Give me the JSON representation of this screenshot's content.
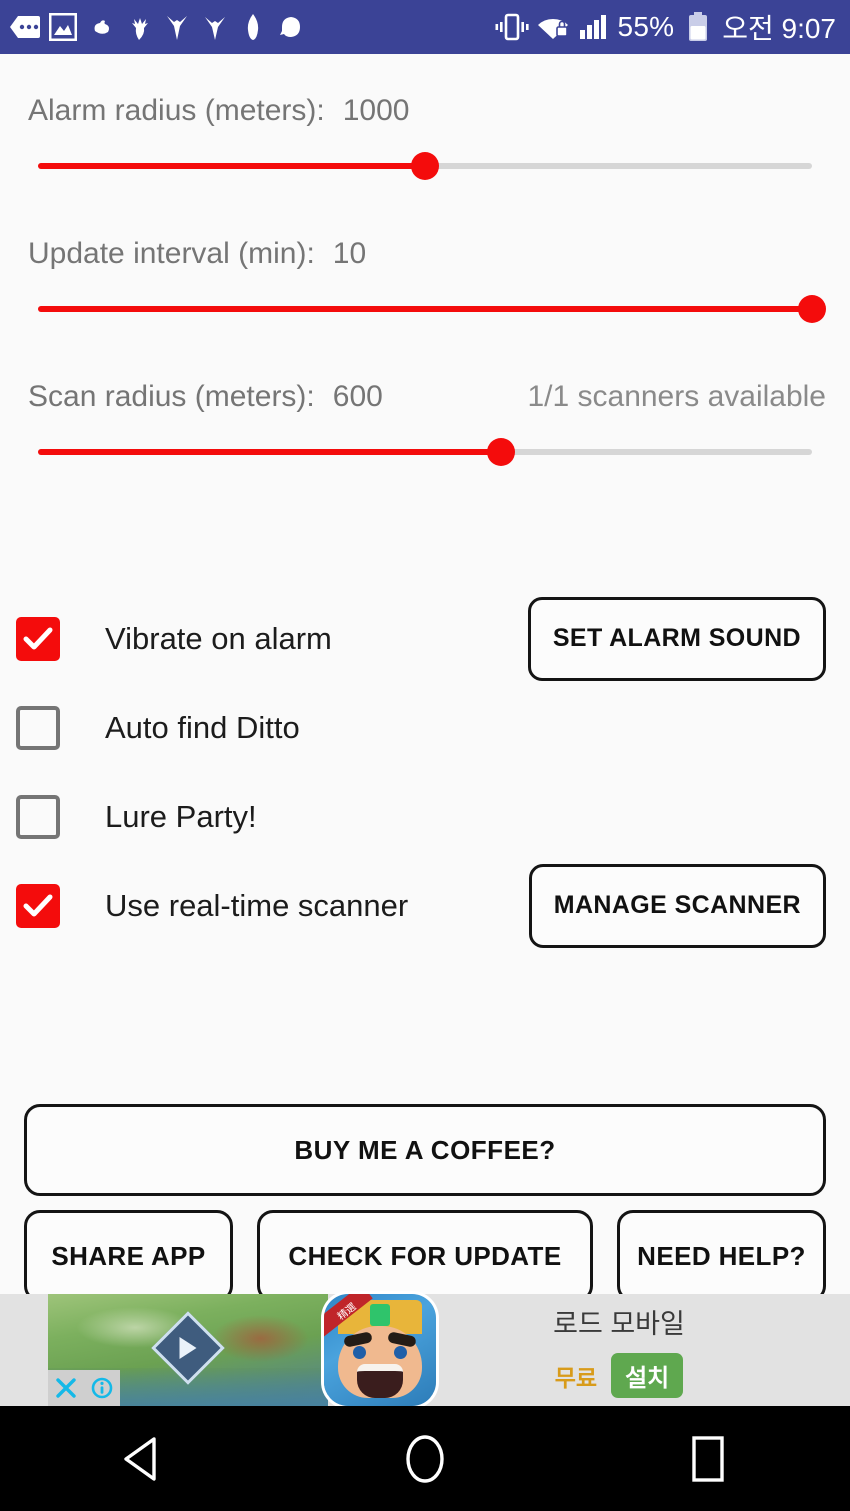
{
  "status_bar": {
    "background": "#3b4396",
    "notification_icons": [
      "message-dots-icon",
      "image-icon",
      "pokemon-shape-1-icon",
      "pokemon-shape-2-icon",
      "pokemon-shape-3-icon",
      "pokemon-shape-4-icon",
      "pokemon-shape-5-icon",
      "pokemon-shape-6-icon"
    ],
    "vibrate_icon": "vibrate-icon",
    "wifi_icon": "wifi-lock-icon",
    "signal_icon": "cellular-signal-icon",
    "battery_percent": "55%",
    "battery_icon": "battery-icon",
    "time": "오전 9:07"
  },
  "settings": {
    "accent_color": "#f40c0c",
    "track_color": "#d6d6d6",
    "label_color": "#757575",
    "sliders": [
      {
        "label": "Alarm radius (meters):",
        "value": "1000",
        "aux": "",
        "fill_percent": 50
      },
      {
        "label": "Update interval (min):",
        "value": "10",
        "aux": "",
        "fill_percent": 100
      },
      {
        "label": "Scan radius (meters):",
        "value": "600",
        "aux": "1/1 scanners available",
        "fill_percent": 59.8
      }
    ],
    "checkboxes": [
      {
        "label": "Vibrate on alarm",
        "checked": true,
        "button": "SET ALARM SOUND"
      },
      {
        "label": "Auto find Ditto",
        "checked": false,
        "button": ""
      },
      {
        "label": "Lure Party!",
        "checked": false,
        "button": ""
      },
      {
        "label": "Use real-time scanner",
        "checked": true,
        "button": "MANAGE SCANNER"
      }
    ]
  },
  "bottom_buttons": {
    "wide": "BUY ME A COFFEE?",
    "row": [
      "SHARE APP",
      "CHECK FOR UPDATE",
      "NEED HELP?"
    ]
  },
  "ad": {
    "title": "로드 모바일",
    "free_label": "무료",
    "install_label": "설치",
    "ribbon_text": "精選",
    "close_icon": "close-x-icon",
    "info_icon": "info-icon",
    "play_icon": "play-icon",
    "install_color": "#5fa84f",
    "free_color": "#d89b1a"
  },
  "nav_bar": {
    "back": "back-triangle-icon",
    "home": "home-circle-icon",
    "recents": "recents-square-icon"
  }
}
